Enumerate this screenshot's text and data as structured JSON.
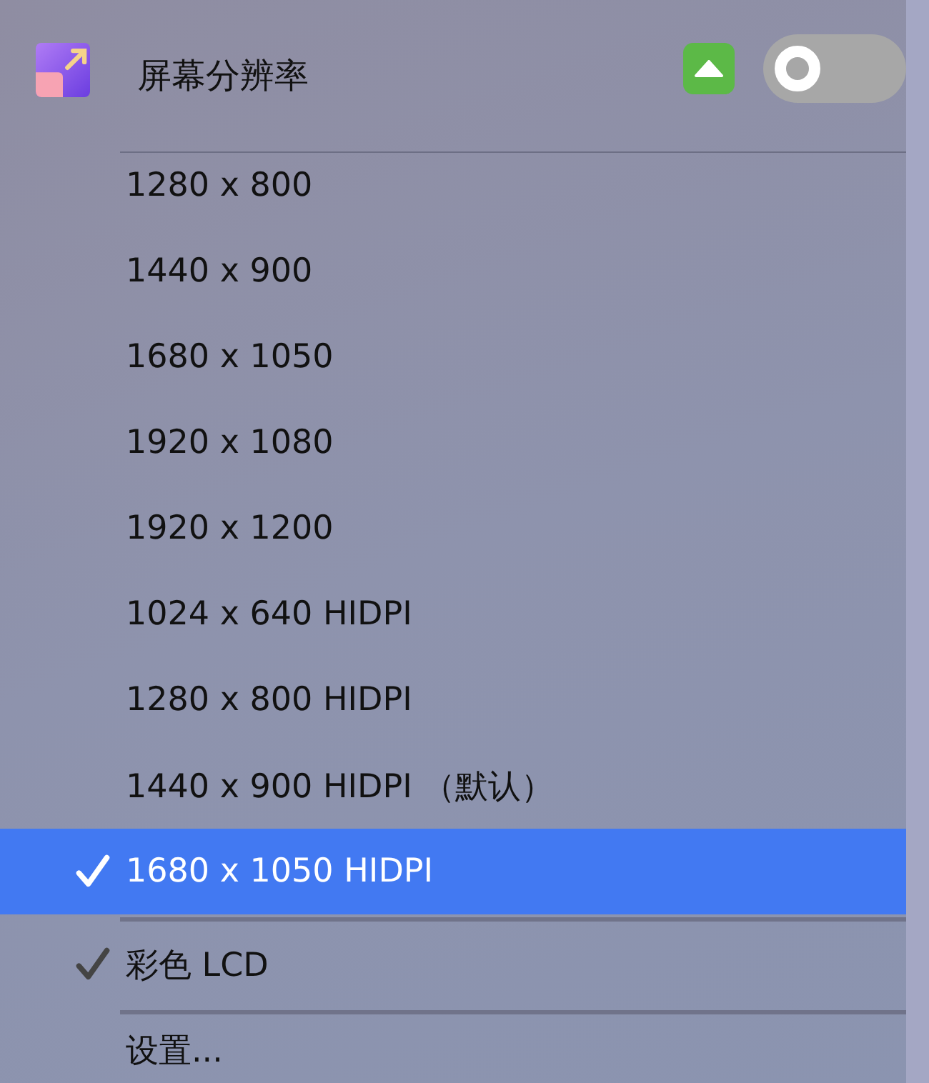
{
  "header": {
    "title": "屏幕分辨率",
    "toggle": {
      "on": false
    }
  },
  "resolutions": [
    {
      "label": "1280 x 800",
      "selected": false
    },
    {
      "label": "1440 x 900",
      "selected": false
    },
    {
      "label": "1680 x 1050",
      "selected": false
    },
    {
      "label": "1920 x 1080",
      "selected": false
    },
    {
      "label": "1920 x 1200",
      "selected": false
    },
    {
      "label": "1024 x 640 HIDPI",
      "selected": false
    },
    {
      "label": "1280 x 800 HIDPI",
      "selected": false
    },
    {
      "label": "1440 x 900 HIDPI （默认）",
      "selected": false
    },
    {
      "label": "1680 x 1050 HIDPI",
      "selected": true
    }
  ],
  "color_lcd": {
    "label": "彩色 LCD",
    "checked": true
  },
  "settings": {
    "label": "设置..."
  }
}
